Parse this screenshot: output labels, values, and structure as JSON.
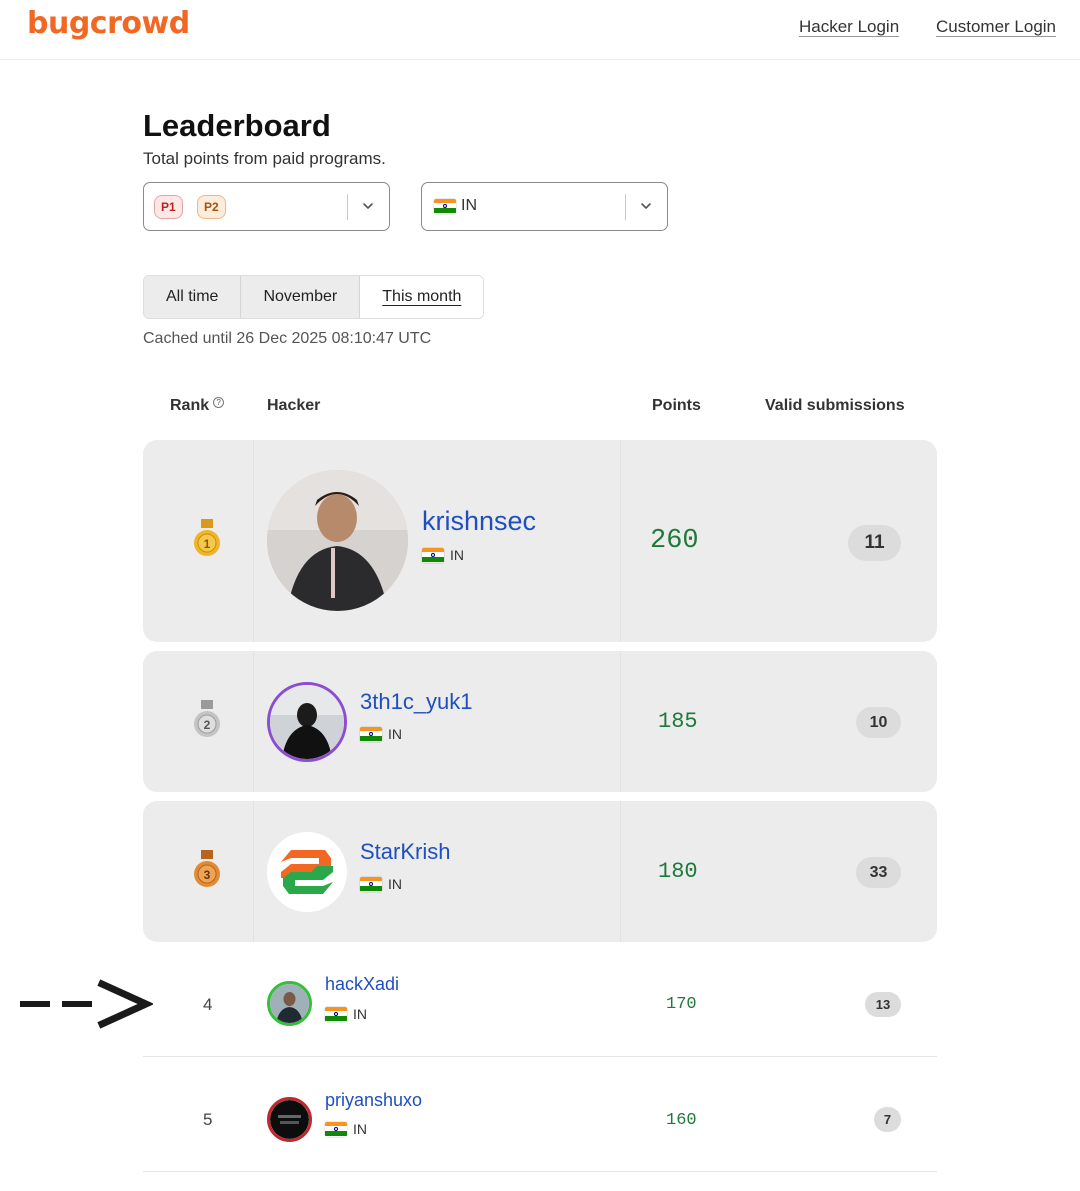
{
  "header": {
    "logo": "bugcrowd",
    "hacker_login": "Hacker Login",
    "customer_login": "Customer Login"
  },
  "page": {
    "title": "Leaderboard",
    "subtitle": "Total points from paid programs."
  },
  "filters": {
    "priority_pills": [
      "P1",
      "P2"
    ],
    "country": "IN"
  },
  "tabs": [
    {
      "label": "All time",
      "active": false
    },
    {
      "label": "November",
      "active": false
    },
    {
      "label": "This month",
      "active": true
    }
  ],
  "cached": "Cached until 26 Dec 2025 08:10:47 UTC",
  "table": {
    "headers": {
      "rank": "Rank",
      "hacker": "Hacker",
      "points": "Points",
      "valid": "Valid submissions"
    },
    "rows": [
      {
        "rank": "1",
        "name": "krishnsec",
        "country": "IN",
        "points": "260",
        "valid": "11",
        "medal": "gold"
      },
      {
        "rank": "2",
        "name": "3th1c_yuk1",
        "country": "IN",
        "points": "185",
        "valid": "10",
        "medal": "silver"
      },
      {
        "rank": "3",
        "name": "StarKrish",
        "country": "IN",
        "points": "180",
        "valid": "33",
        "medal": "bronze"
      },
      {
        "rank": "4",
        "name": "hackXadi",
        "country": "IN",
        "points": "170",
        "valid": "13"
      },
      {
        "rank": "5",
        "name": "priyanshuxo",
        "country": "IN",
        "points": "160",
        "valid": "7"
      }
    ]
  },
  "annotation": {
    "arrow": "-->"
  },
  "colors": {
    "brand": "#f26822",
    "link": "#1f4fbf",
    "points": "#1f7a3a",
    "gold": "#f0b429",
    "silver": "#b8b8b8",
    "bronze": "#d9822b"
  }
}
